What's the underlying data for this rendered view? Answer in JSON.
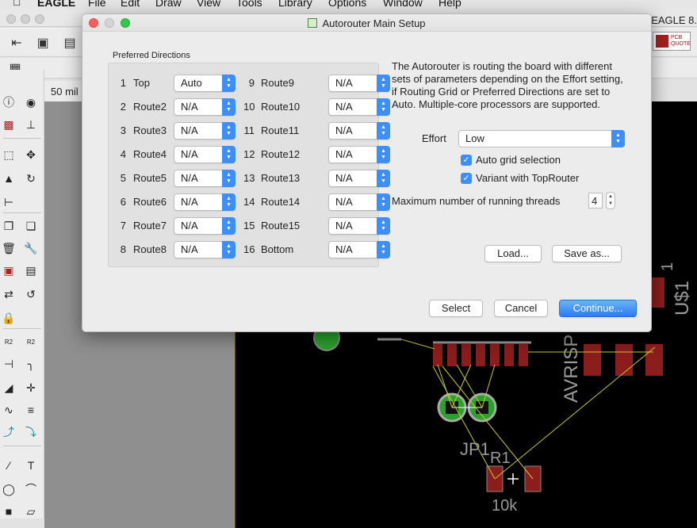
{
  "menubar": {
    "app": "EAGLE",
    "items": [
      "File",
      "Edit",
      "Draw",
      "View",
      "Tools",
      "Library",
      "Options",
      "Window",
      "Help"
    ]
  },
  "window": {
    "title": "EAGLE 8.",
    "grid_label": "50 mil",
    "pcb_quote": [
      "PCB",
      "QUOTE"
    ]
  },
  "dialog": {
    "title": "Autorouter Main Setup",
    "preferred_label": "Preferred Directions",
    "layers_left": [
      {
        "num": "1",
        "name": "Top",
        "value": "Auto"
      },
      {
        "num": "2",
        "name": "Route2",
        "value": "N/A"
      },
      {
        "num": "3",
        "name": "Route3",
        "value": "N/A"
      },
      {
        "num": "4",
        "name": "Route4",
        "value": "N/A"
      },
      {
        "num": "5",
        "name": "Route5",
        "value": "N/A"
      },
      {
        "num": "6",
        "name": "Route6",
        "value": "N/A"
      },
      {
        "num": "7",
        "name": "Route7",
        "value": "N/A"
      },
      {
        "num": "8",
        "name": "Route8",
        "value": "N/A"
      }
    ],
    "layers_right": [
      {
        "num": "9",
        "name": "Route9",
        "value": "N/A"
      },
      {
        "num": "10",
        "name": "Route10",
        "value": "N/A"
      },
      {
        "num": "11",
        "name": "Route11",
        "value": "N/A"
      },
      {
        "num": "12",
        "name": "Route12",
        "value": "N/A"
      },
      {
        "num": "13",
        "name": "Route13",
        "value": "N/A"
      },
      {
        "num": "14",
        "name": "Route14",
        "value": "N/A"
      },
      {
        "num": "15",
        "name": "Route15",
        "value": "N/A"
      },
      {
        "num": "16",
        "name": "Bottom",
        "value": "N/A"
      }
    ],
    "description": "The Autorouter is routing the board with different sets of parameters depending on the Effort setting, if Routing Grid or Preferred Directions are set to Auto. Multiple-core processors are supported.",
    "effort_label": "Effort",
    "effort_value": "Low",
    "auto_grid_label": "Auto grid selection",
    "variant_label": "Variant with TopRouter",
    "threads_label": "Maximum number of running threads",
    "threads_value": "4",
    "load_button": "Load...",
    "save_button": "Save as...",
    "select_button": "Select",
    "cancel_button": "Cancel",
    "continue_button": "Continue..."
  },
  "board": {
    "labels": [
      "JP1",
      "R1",
      "10k",
      "AVRISP",
      "U$1",
      "1"
    ]
  },
  "colors": {
    "accent": "#3d8ef6",
    "pad_green": "#2aa12a",
    "copper_red": "#8c1d1d",
    "airwire": "#c8c832"
  }
}
